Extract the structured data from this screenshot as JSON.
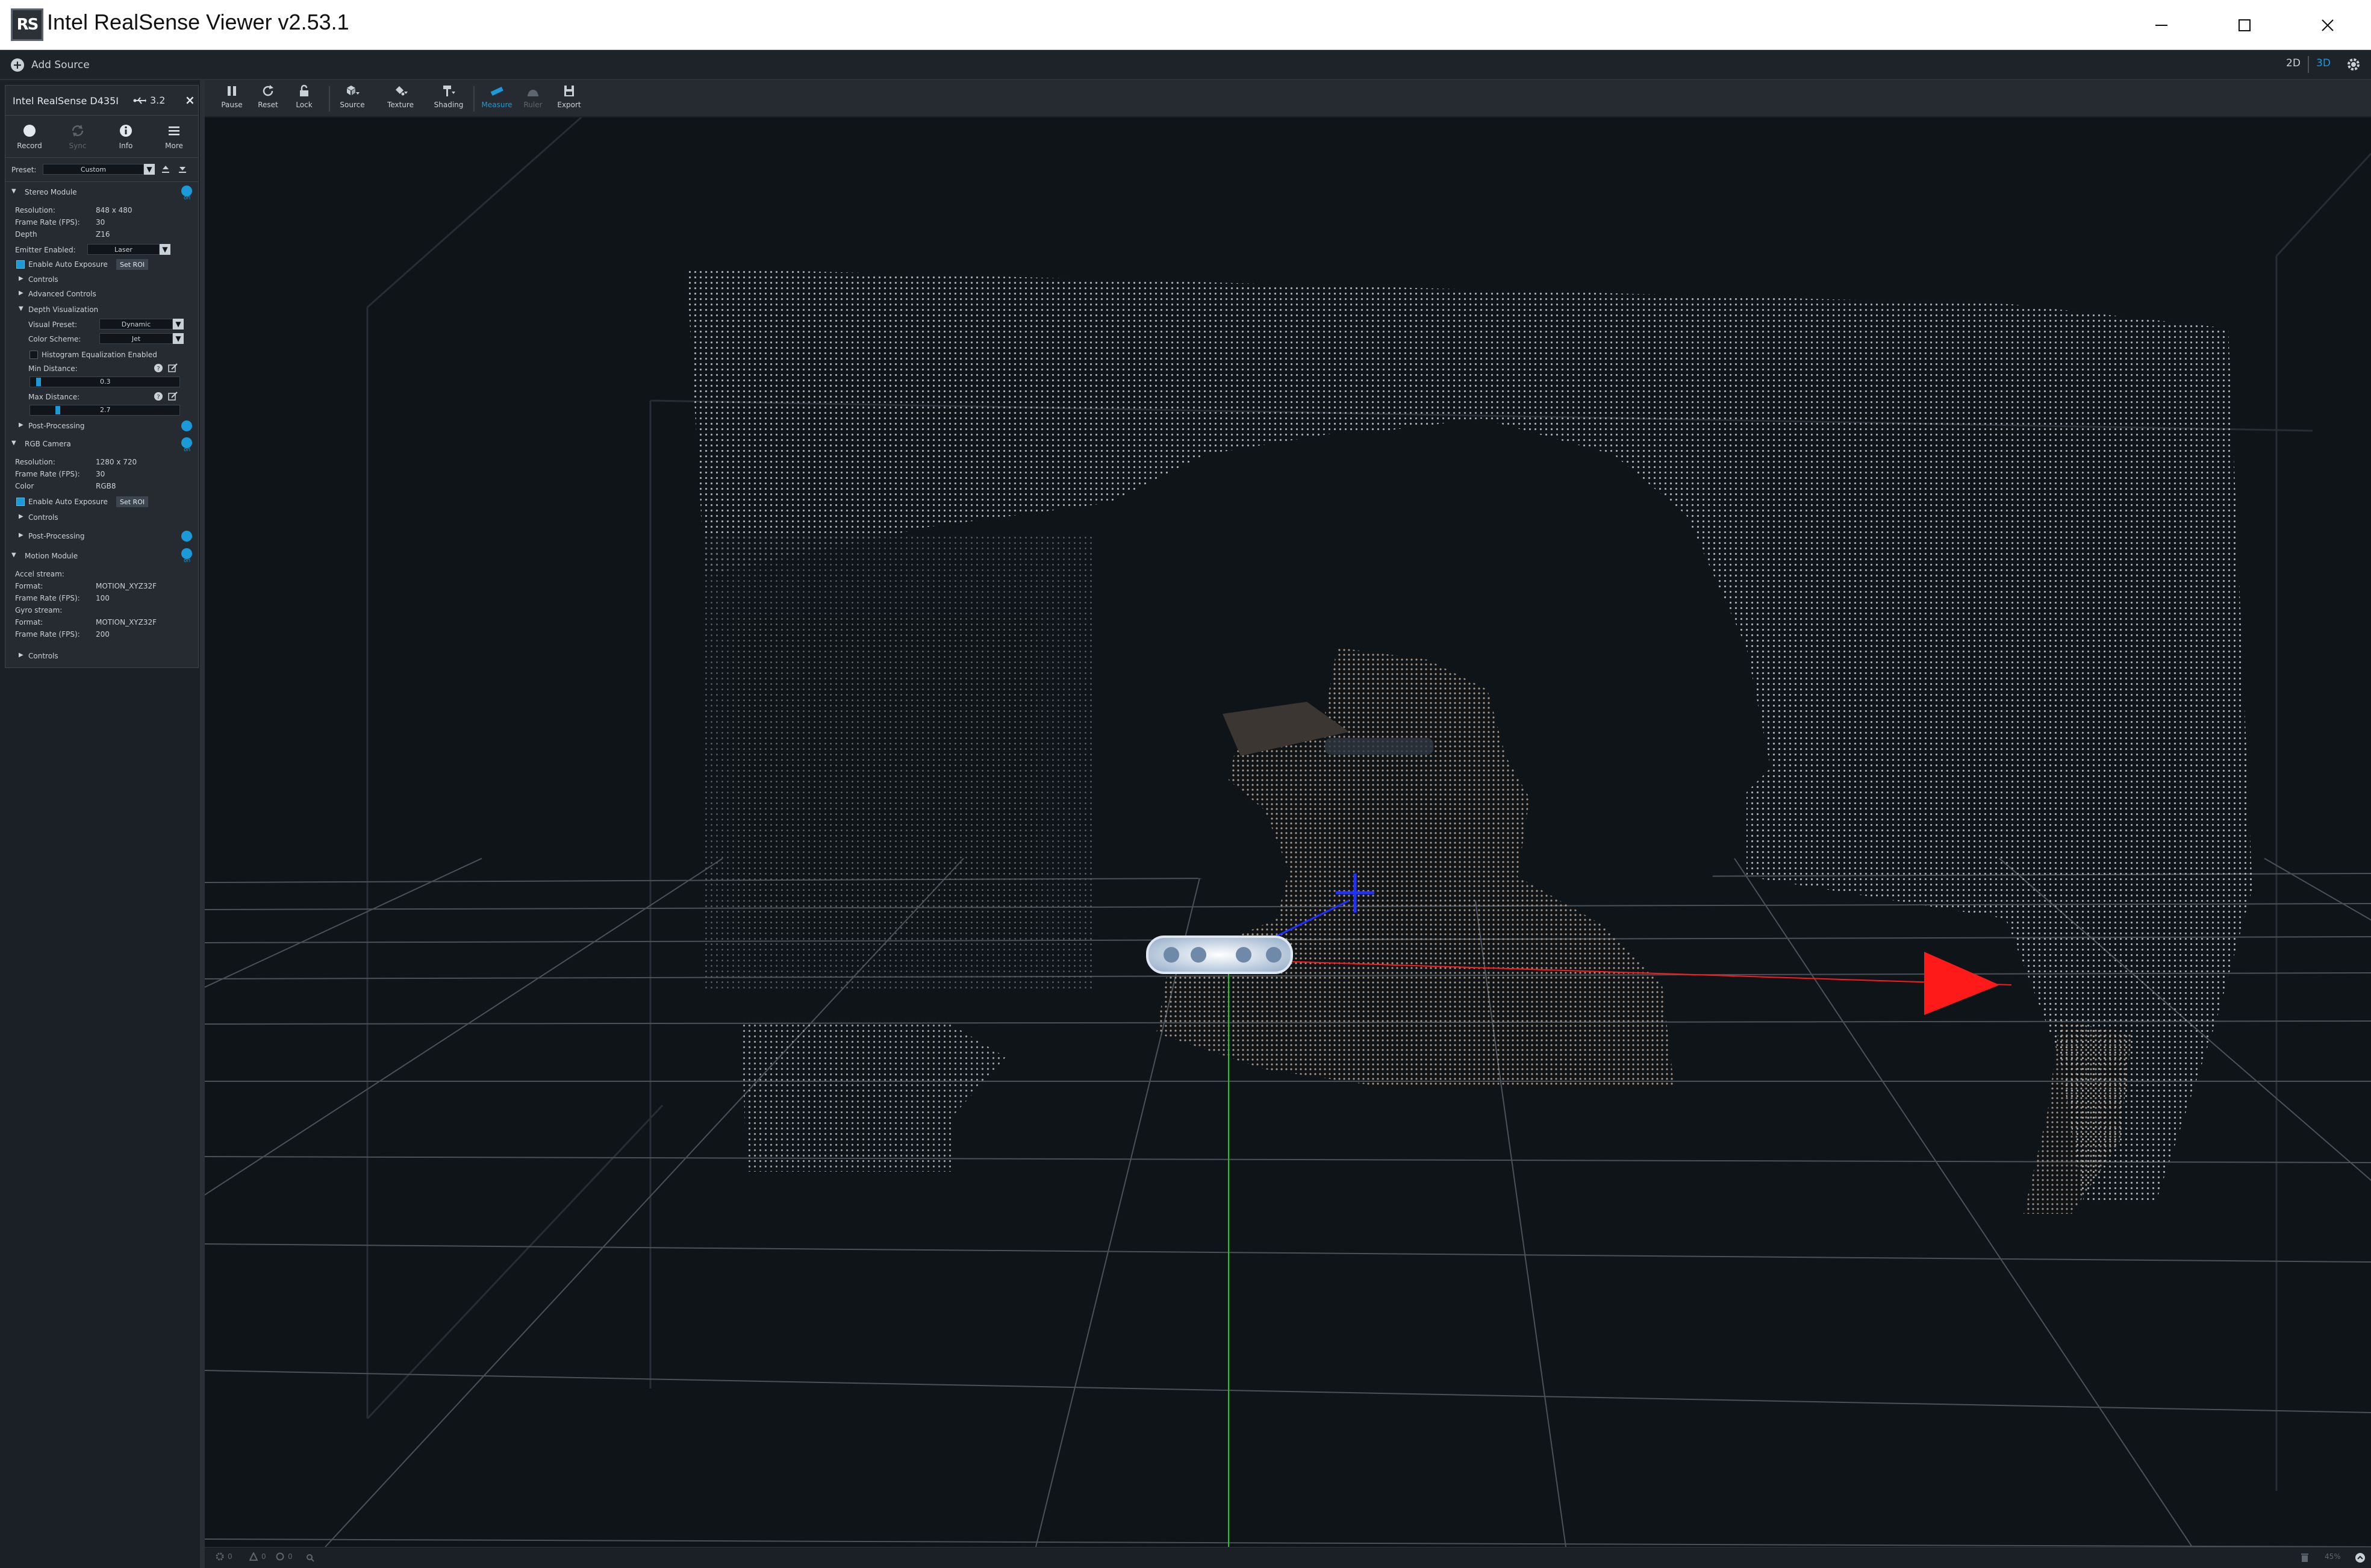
{
  "window": {
    "title": "Intel RealSense Viewer v2.53.1",
    "logo_text": "RS"
  },
  "topstrip": {
    "add_source": "Add Source",
    "mode_2d": "2D",
    "mode_3d": "3D"
  },
  "device": {
    "name": "Intel RealSense D435I",
    "usb": "3.2",
    "close": "×",
    "actions": [
      {
        "label": "Record",
        "icon": "record-icon"
      },
      {
        "label": "Sync",
        "icon": "sync-icon"
      },
      {
        "label": "Info",
        "icon": "info-icon"
      },
      {
        "label": "More",
        "icon": "menu-icon"
      }
    ],
    "preset_label": "Preset:",
    "preset_value": "Custom"
  },
  "stereo": {
    "title": "Stereo Module",
    "toggle_label": "on",
    "resolution_label": "Resolution:",
    "resolution": "848 x 480",
    "fps_label": "Frame Rate (FPS):",
    "fps": "30",
    "depth_label": "Depth",
    "depth": "Z16",
    "emitter_label": "Emitter Enabled:",
    "emitter": "Laser",
    "auto_exposure": "Enable Auto Exposure",
    "set_roi": "Set ROI",
    "controls": "Controls",
    "advanced": "Advanced Controls",
    "depth_vis": "Depth Visualization",
    "visual_preset_label": "Visual Preset:",
    "visual_preset": "Dynamic",
    "color_scheme_label": "Color Scheme:",
    "color_scheme": "Jet",
    "histogram": "Histogram Equalization Enabled",
    "min_label": "Min Distance:",
    "min_value": "0.3",
    "max_label": "Max Distance:",
    "max_value": "2.7",
    "post": "Post-Processing"
  },
  "rgb": {
    "title": "RGB Camera",
    "toggle_label": "on",
    "resolution_label": "Resolution:",
    "resolution": "1280 x 720",
    "fps_label": "Frame Rate (FPS):",
    "fps": "30",
    "color_label": "Color",
    "color": "RGB8",
    "auto_exposure": "Enable Auto Exposure",
    "set_roi": "Set ROI",
    "controls": "Controls",
    "post": "Post-Processing"
  },
  "motion": {
    "title": "Motion Module",
    "toggle_label": "on",
    "accel_label": "Accel stream:",
    "format_label": "Format:",
    "accel_format": "MOTION_XYZ32F",
    "accel_fps_label": "Frame Rate (FPS):",
    "accel_fps": "100",
    "gyro_label": "Gyro stream:",
    "gyro_format_label": "Format:",
    "gyro_format": "MOTION_XYZ32F",
    "gyro_fps_label": "Frame Rate (FPS):",
    "gyro_fps": "200",
    "controls": "Controls"
  },
  "toolbar": {
    "items": [
      {
        "label": "Pause",
        "icon": "pause-icon"
      },
      {
        "label": "Reset",
        "icon": "reset-icon"
      },
      {
        "label": "Lock",
        "icon": "lock-icon"
      },
      {
        "label": "Source",
        "icon": "source-icon"
      },
      {
        "label": "Texture",
        "icon": "texture-icon"
      },
      {
        "label": "Shading",
        "icon": "shading-icon"
      },
      {
        "label": "Measure",
        "icon": "measure-icon"
      },
      {
        "label": "Ruler",
        "icon": "ruler-icon"
      },
      {
        "label": "Export",
        "icon": "export-icon"
      }
    ]
  },
  "status": {
    "items": [
      "0",
      "0",
      "0"
    ],
    "right_pct": "45%"
  },
  "colors": {
    "accent": "#1a9ad8",
    "panel": "#262b32",
    "viewport": "#0f1419",
    "x_axis": "#ff1a1a",
    "y_axis": "#22c422",
    "z_axis": "#2030ff"
  }
}
